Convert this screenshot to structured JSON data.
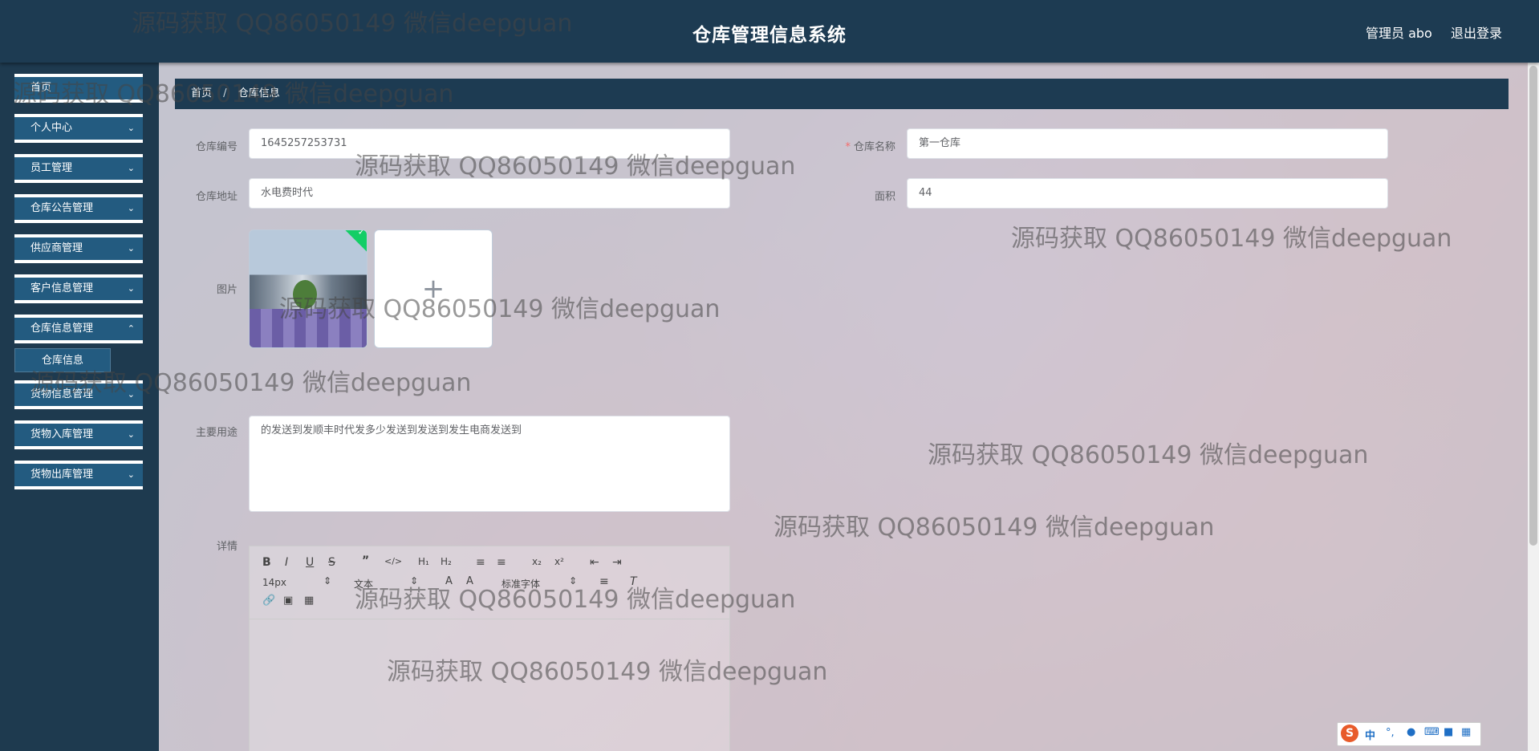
{
  "header": {
    "title": "仓库管理信息系统",
    "user": "管理员 abo",
    "logout": "退出登录"
  },
  "sidebar": {
    "items": [
      {
        "label": "首页"
      },
      {
        "label": "个人中心"
      },
      {
        "label": "员工管理"
      },
      {
        "label": "仓库公告管理"
      },
      {
        "label": "供应商管理"
      },
      {
        "label": "客户信息管理"
      },
      {
        "label": "仓库信息管理"
      },
      {
        "label": "货物信息管理"
      },
      {
        "label": "货物入库管理"
      },
      {
        "label": "货物出库管理"
      }
    ],
    "submenu": {
      "label": "仓库信息"
    }
  },
  "breadcrumb": {
    "home": "首页",
    "separator": "/",
    "current": "仓库信息"
  },
  "form": {
    "code_label": "仓库编号",
    "code_value": "1645257253731",
    "name_label": "仓库名称",
    "name_value": "第一仓库",
    "address_label": "仓库地址",
    "address_value": "水电费时代",
    "area_label": "面积",
    "area_value": "44",
    "image_label": "图片",
    "upload_plus": "+",
    "usage_label": "主要用途",
    "usage_value": "的发送到发顺丰时代发多少发送到发送到发生电商发送到",
    "detail_label": "详情"
  },
  "editor": {
    "font_size": "14px",
    "paragraph": "文本",
    "font_family": "标准字体"
  },
  "watermark_text": "源码获取 QQ86050149 微信deepguan",
  "ime": {
    "logo": "S",
    "mode": "中"
  }
}
